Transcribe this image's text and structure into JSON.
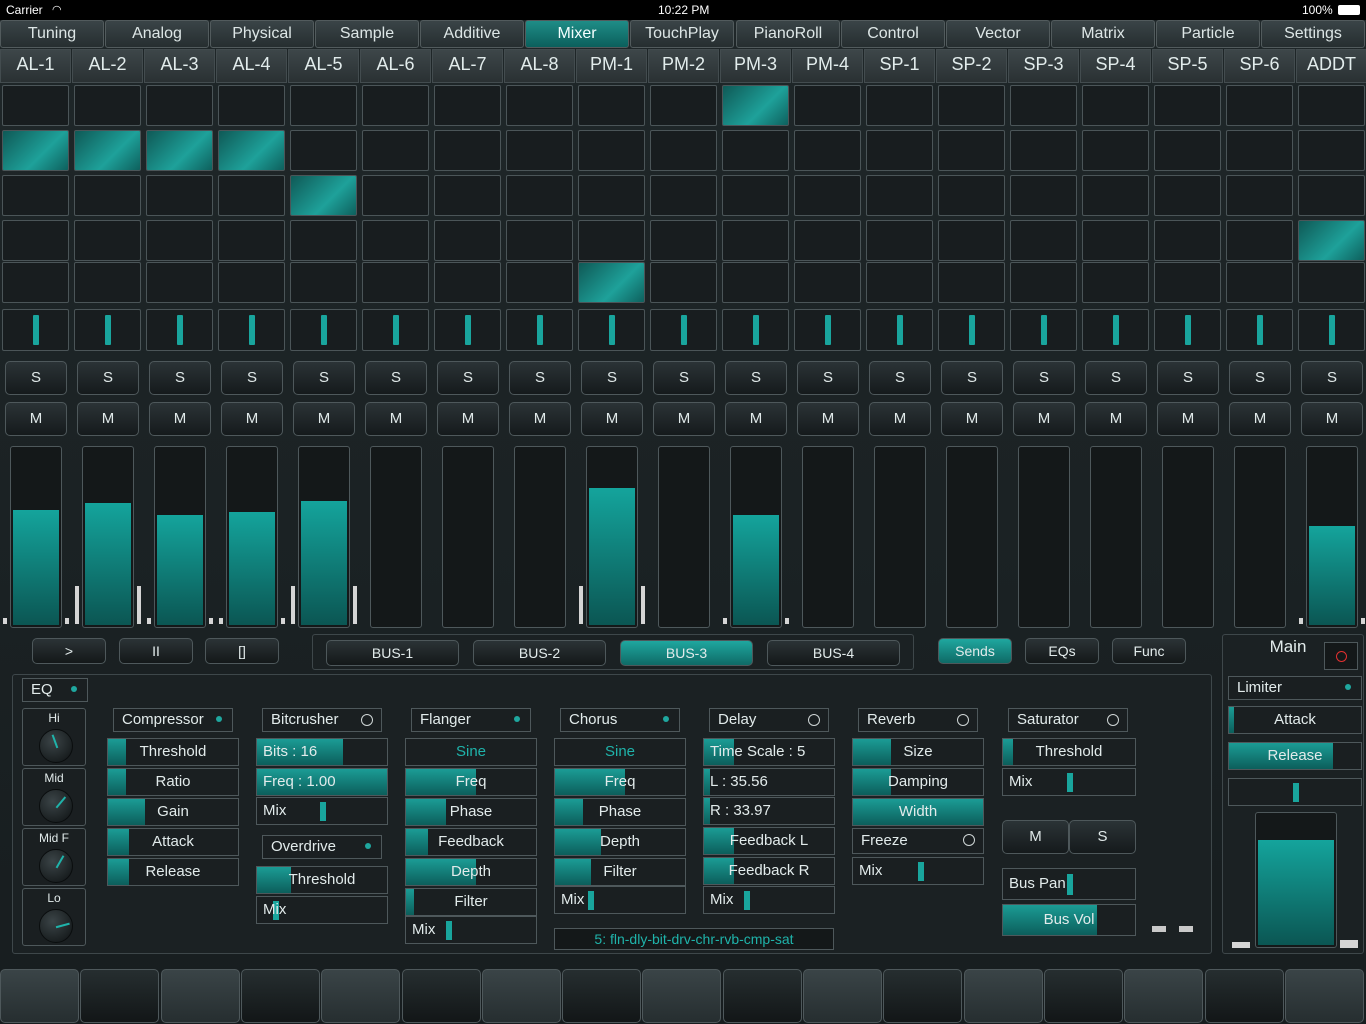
{
  "status": {
    "carrier": "Carrier",
    "time": "10:22 PM",
    "battery": "100%"
  },
  "tabs": [
    "Tuning",
    "Analog",
    "Physical",
    "Sample",
    "Additive",
    "Mixer",
    "TouchPlay",
    "PianoRoll",
    "Control",
    "Vector",
    "Matrix",
    "Particle",
    "Settings"
  ],
  "active_tab": "Mixer",
  "channels": [
    {
      "name": "AL-1",
      "send_on": 1,
      "level": 0.64
    },
    {
      "name": "AL-2",
      "send_on": 1,
      "level": 0.68
    },
    {
      "name": "AL-3",
      "send_on": 1,
      "level": 0.61
    },
    {
      "name": "AL-4",
      "send_on": 1,
      "level": 0.63
    },
    {
      "name": "AL-5",
      "send_on": 2,
      "level": 0.69
    },
    {
      "name": "AL-6",
      "send_on": -1,
      "level": 0
    },
    {
      "name": "AL-7",
      "send_on": -1,
      "level": 0
    },
    {
      "name": "AL-8",
      "send_on": -1,
      "level": 0
    },
    {
      "name": "PM-1",
      "send_on": 4,
      "level": 0.76
    },
    {
      "name": "PM-2",
      "send_on": -1,
      "level": 0
    },
    {
      "name": "PM-3",
      "send_on": 0,
      "level": 0.61
    },
    {
      "name": "PM-4",
      "send_on": -1,
      "level": 0
    },
    {
      "name": "SP-1",
      "send_on": -1,
      "level": 0
    },
    {
      "name": "SP-2",
      "send_on": -1,
      "level": 0
    },
    {
      "name": "SP-3",
      "send_on": -1,
      "level": 0
    },
    {
      "name": "SP-4",
      "send_on": -1,
      "level": 0
    },
    {
      "name": "SP-5",
      "send_on": -1,
      "level": 0
    },
    {
      "name": "SP-6",
      "send_on": -1,
      "level": 0
    },
    {
      "name": "ADDT",
      "send_on": 3,
      "level": 0.55
    }
  ],
  "solo_label": "S",
  "mute_label": "M",
  "transport": {
    "play": ">",
    "pause": "II",
    "stop": "[]"
  },
  "buses": [
    "BUS-1",
    "BUS-2",
    "BUS-3",
    "BUS-4"
  ],
  "active_bus": "BUS-3",
  "modes": [
    "Sends",
    "EQs",
    "Func"
  ],
  "active_mode": "Sends",
  "main": {
    "title": "Main",
    "limiter": "Limiter",
    "attack": "Attack",
    "release": "Release",
    "level": 0.78
  },
  "eq": {
    "title": "EQ",
    "bands": [
      "Hi",
      "Mid",
      "Mid F",
      "Lo"
    ]
  },
  "compressor": {
    "title": "Compressor",
    "params": [
      {
        "label": "Threshold",
        "value": 0.14
      },
      {
        "label": "Ratio",
        "value": 0.14
      },
      {
        "label": "Gain",
        "value": 0.28
      },
      {
        "label": "Attack",
        "value": 0.16
      },
      {
        "label": "Release",
        "value": 0.16
      }
    ]
  },
  "bitcrusher": {
    "title": "Bitcrusher",
    "bits": "Bits : 16",
    "freq": "Freq : 1.00",
    "mix": "Mix"
  },
  "overdrive": {
    "title": "Overdrive",
    "threshold": "Threshold",
    "mix": "Mix"
  },
  "flanger": {
    "title": "Flanger",
    "wave": "Sine",
    "params": [
      "Freq",
      "Phase",
      "Feedback",
      "Depth",
      "Filter"
    ],
    "mix": "Mix"
  },
  "chorus": {
    "title": "Chorus",
    "wave": "Sine",
    "params": [
      "Freq",
      "Phase",
      "Depth",
      "Filter"
    ],
    "mix": "Mix"
  },
  "delay": {
    "title": "Delay",
    "time_scale": "Time Scale : 5",
    "l": "L : 35.56",
    "r": "R : 33.97",
    "feedback_l": "Feedback L",
    "feedback_r": "Feedback R",
    "mix": "Mix"
  },
  "reverb": {
    "title": "Reverb",
    "params": [
      "Size",
      "Damping",
      "Width"
    ],
    "freeze": "Freeze",
    "mix": "Mix"
  },
  "saturator": {
    "title": "Saturator",
    "threshold": "Threshold",
    "mix": "Mix",
    "m": "M",
    "s": "S",
    "bus_pan": "Bus Pan",
    "bus_vol": "Bus Vol"
  },
  "chain": "5: fln-dly-bit-drv-chr-rvb-cmp-sat",
  "pads_count": 17
}
